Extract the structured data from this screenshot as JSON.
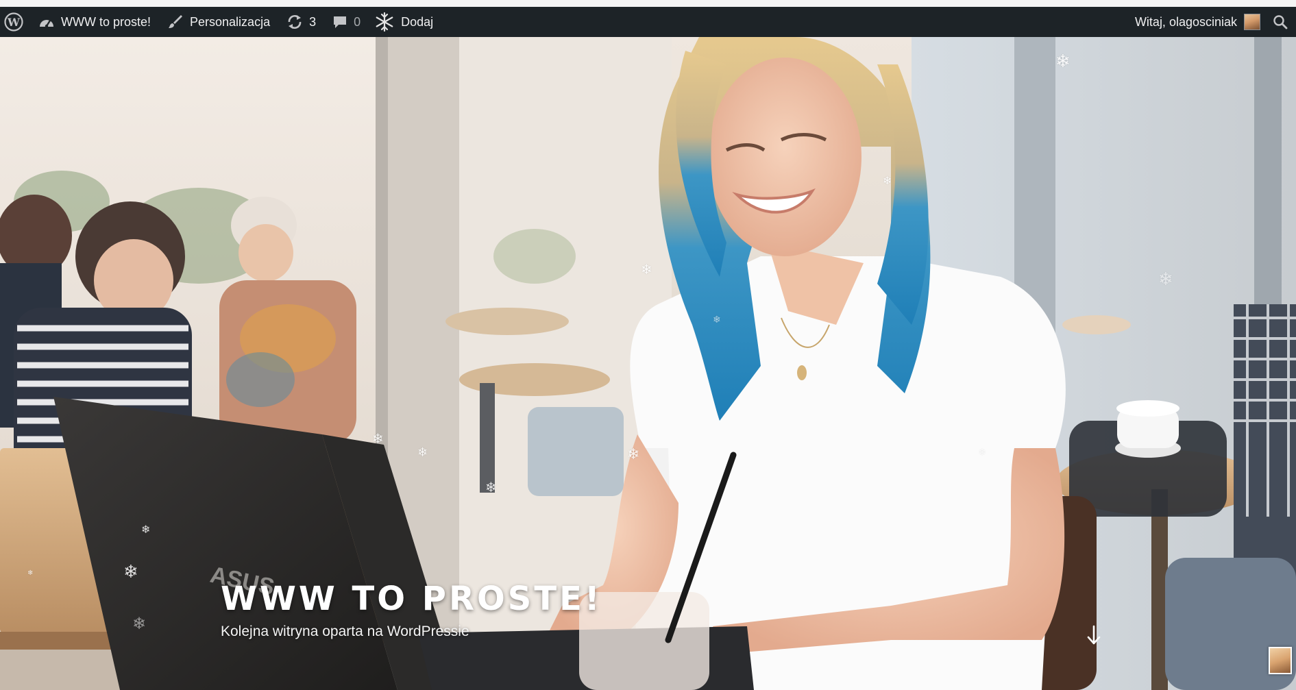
{
  "adminbar": {
    "site_name": "WWW to proste!",
    "customize_label": "Personalizacja",
    "updates_count": "3",
    "comments_count": "0",
    "new_label": "Dodaj",
    "greeting": "Witaj, olagosciniak",
    "icons": {
      "wp_logo": "wordpress-logo-icon",
      "site": "dashboard-icon",
      "customize": "paintbrush-icon",
      "updates": "refresh-icon",
      "comments": "comment-bubble-icon",
      "new": "snowflake-icon",
      "search": "search-icon"
    },
    "colors": {
      "background": "#1d2327",
      "text": "#f0f0f1",
      "muted": "#a7aaad"
    }
  },
  "hero": {
    "title": "WWW TO PROSTE!",
    "subtitle": "Kolejna witryna oparta na WordPressie",
    "scroll_icon": "arrow-down-icon",
    "image": "woman-with-laptop-in-cafe",
    "decoration": "falling-snowflakes"
  }
}
